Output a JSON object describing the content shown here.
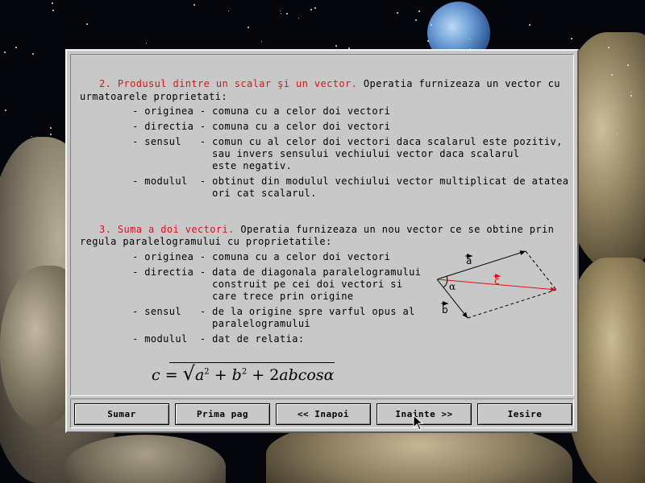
{
  "section2": {
    "heading": "2. Produsul dintre un scalar şi un vector.",
    "intro_tail": " Operatia furnizeaza un vector cu",
    "intro_line2": "urmatoarele proprietati:",
    "lines": [
      "- originea - comuna cu a celor doi vectori",
      "- directia - comuna cu a celor doi vectori",
      "- sensul   - comun cu al celor doi vectori daca scalarul este pozitiv,",
      "             sau invers sensului vechiului vector daca scalarul",
      "             este negativ.",
      "- modulul  - obtinut din modulul vechiului vector multiplicat de atatea",
      "             ori cat scalarul."
    ]
  },
  "section3": {
    "heading": "3. Suma a doi vectori.",
    "intro_tail": " Operatia furnizeaza un nou vector ce se obtine prin",
    "intro_line2": "regula paralelogramului cu proprietatile:",
    "lines": [
      "- originea - comuna cu a celor doi vectori",
      "- directia - data de diagonala paralelogramului",
      "             construit pe cei doi vectori si",
      "             care trece prin origine",
      "- sensul   - de la origine spre varful opus al",
      "             paralelogramului",
      "- modulul  - dat de relatia:"
    ]
  },
  "diagram": {
    "label_a": "a",
    "label_b": "b",
    "label_c": "c",
    "label_alpha": "α",
    "colors": {
      "c_vector": "#e01010",
      "lines": "#000000"
    }
  },
  "formula": {
    "lhs": "c",
    "eq": " = ",
    "a": "a",
    "b": "b",
    "sup": "2",
    "plus1": " + ",
    "plus2": " + 2",
    "abcos": "abcos",
    "alpha": "α"
  },
  "buttons": {
    "sumar": "Sumar",
    "prima": "Prima pag",
    "inapoi": "<< Inapoi",
    "inainte": "Inainte >>",
    "iesire": "Iesire"
  },
  "colors": {
    "heading": "#d8141c",
    "window": "#c8c8c8"
  }
}
